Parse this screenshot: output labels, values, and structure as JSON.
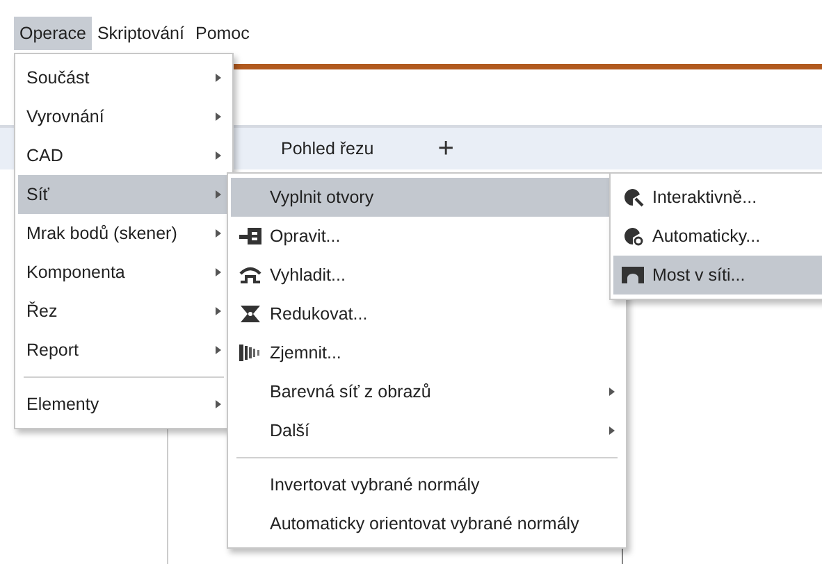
{
  "menubar": [
    {
      "label": "Operace",
      "selected": true
    },
    {
      "label": "Skriptování",
      "selected": false
    },
    {
      "label": "Pomoc",
      "selected": false
    }
  ],
  "tabs": [
    {
      "label": "Pohled řezu"
    }
  ],
  "add_tab": "+",
  "menus": [
    {
      "items": [
        {
          "kind": "item",
          "label": "Součást",
          "submenu": true,
          "selected": false
        },
        {
          "kind": "item",
          "label": "Vyrovnání",
          "submenu": true,
          "selected": false
        },
        {
          "kind": "item",
          "label": "CAD",
          "submenu": true,
          "selected": false
        },
        {
          "kind": "item",
          "label": "Síť",
          "submenu": true,
          "selected": true
        },
        {
          "kind": "item",
          "label": "Mrak bodů (skener)",
          "submenu": true,
          "selected": false
        },
        {
          "kind": "item",
          "label": "Komponenta",
          "submenu": true,
          "selected": false
        },
        {
          "kind": "item",
          "label": "Řez",
          "submenu": true,
          "selected": false
        },
        {
          "kind": "item",
          "label": "Report",
          "submenu": true,
          "selected": false
        },
        {
          "kind": "separator"
        },
        {
          "kind": "item",
          "label": "Elementy",
          "submenu": true,
          "selected": false
        }
      ]
    },
    {
      "items": [
        {
          "kind": "item",
          "label": "Vyplnit otvory",
          "submenu": true,
          "selected": true
        },
        {
          "kind": "item",
          "label": "Opravit...",
          "selected": false
        },
        {
          "kind": "item",
          "label": "Vyhladit...",
          "selected": false
        },
        {
          "kind": "item",
          "label": "Redukovat...",
          "selected": false
        },
        {
          "kind": "item",
          "label": "Zjemnit...",
          "selected": false
        },
        {
          "kind": "item",
          "label": "Barevná síť z obrazů",
          "submenu": true,
          "selected": false
        },
        {
          "kind": "item",
          "label": "Další",
          "submenu": true,
          "selected": false
        },
        {
          "kind": "separator"
        },
        {
          "kind": "item",
          "label": "Invertovat vybrané normály",
          "selected": false
        },
        {
          "kind": "item",
          "label": "Automaticky orientovat vybrané normály",
          "selected": false
        }
      ]
    },
    {
      "items": [
        {
          "kind": "item",
          "label": "Interaktivně...",
          "selected": false
        },
        {
          "kind": "item",
          "label": "Automaticky...",
          "selected": false
        },
        {
          "kind": "item",
          "label": "Most v síti...",
          "selected": true
        }
      ]
    }
  ]
}
